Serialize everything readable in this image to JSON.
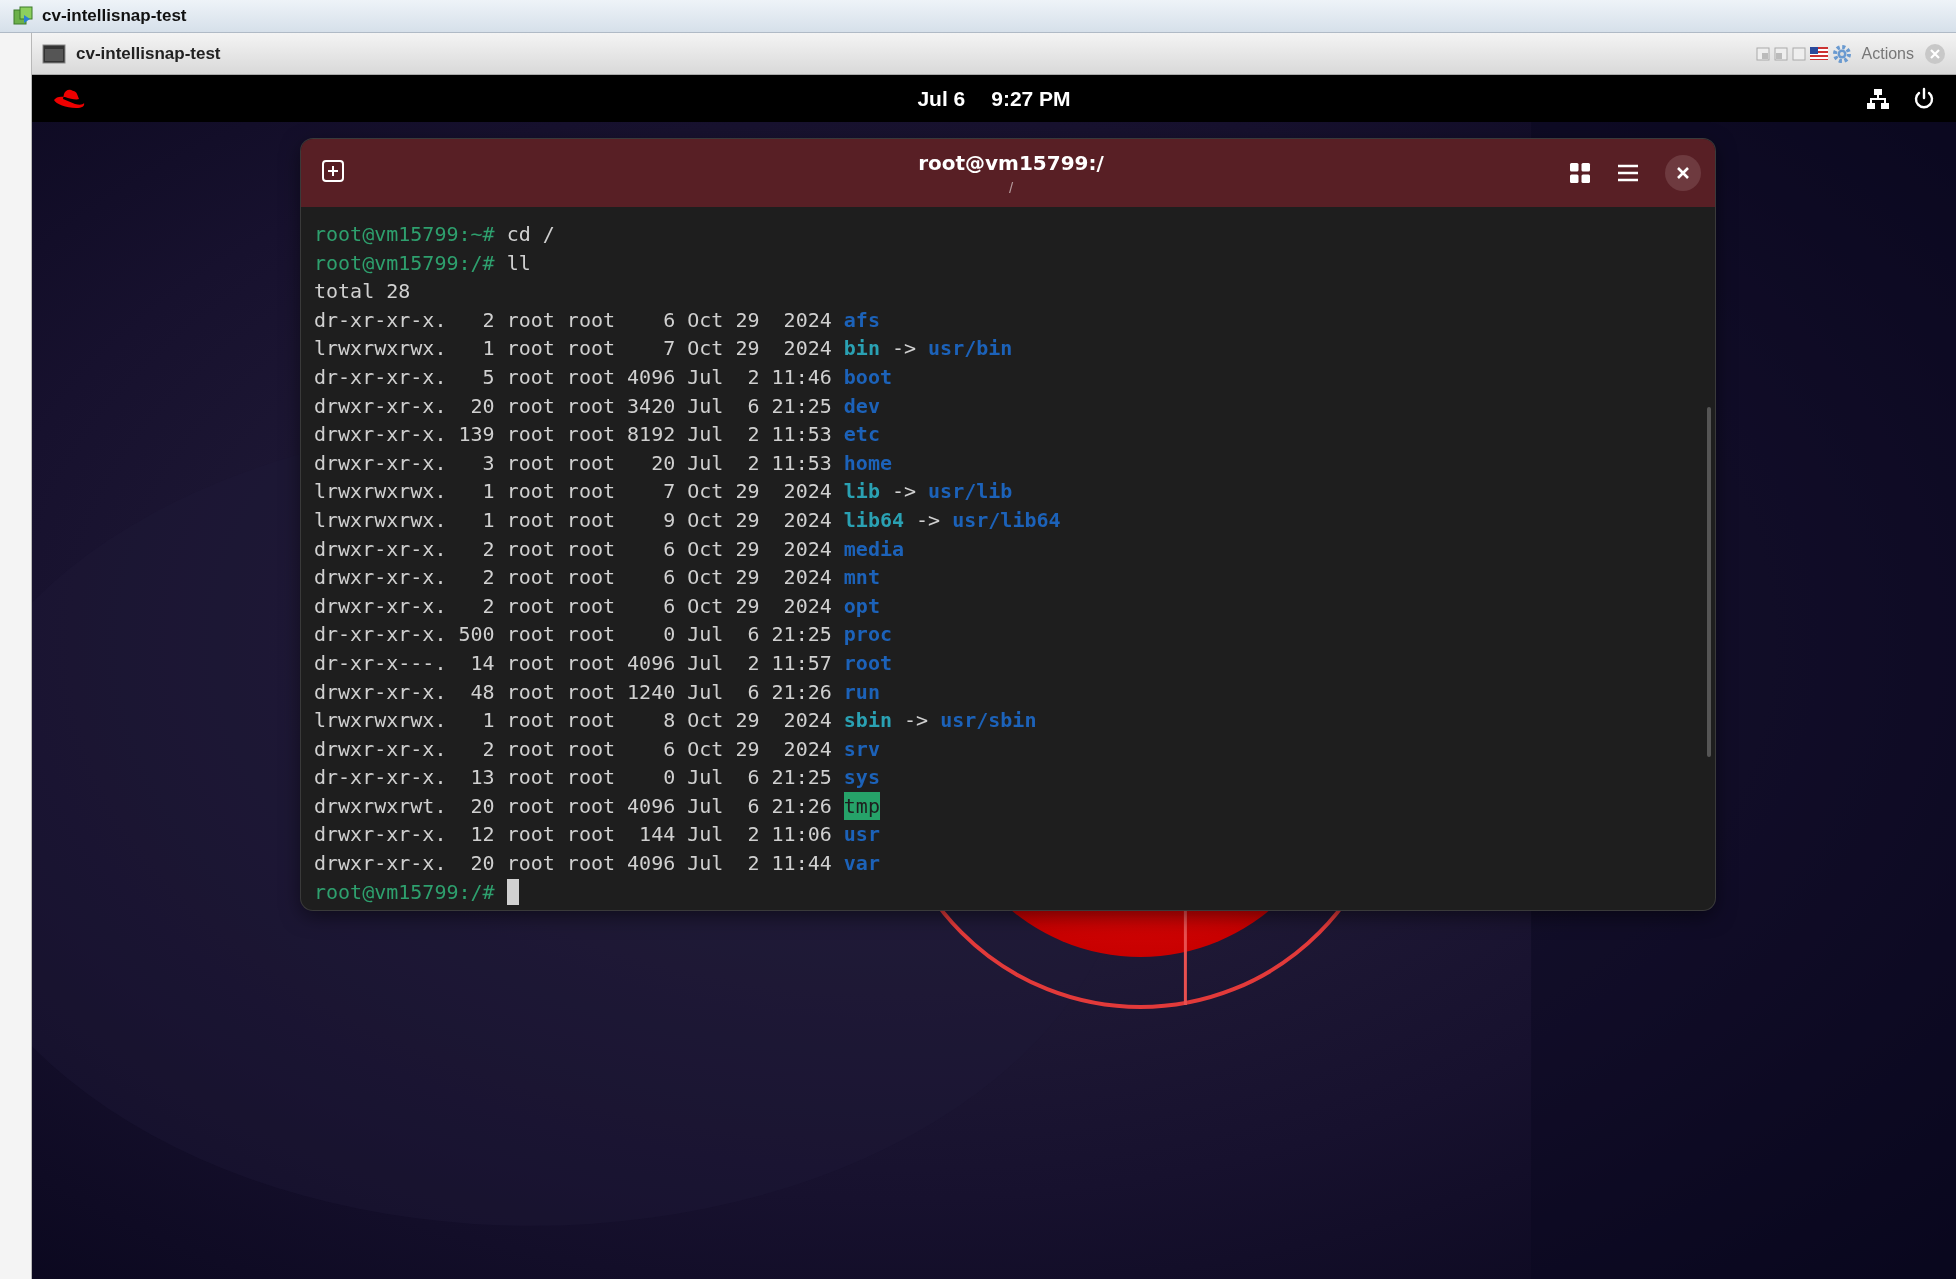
{
  "outer_window": {
    "title": "cv-intellisnap-test"
  },
  "console_window": {
    "title": "cv-intellisnap-test",
    "actions_label": "Actions"
  },
  "top_bar": {
    "date": "Jul 6",
    "time": "9:27 PM"
  },
  "terminal": {
    "title": "root@vm15799:/",
    "subtitle": "/",
    "lines": [
      {
        "kind": "prompt",
        "prompt": "root@vm15799:~#",
        "command": "cd /"
      },
      {
        "kind": "prompt",
        "prompt": "root@vm15799:/#",
        "command": "ll"
      },
      {
        "kind": "text",
        "text": "total 28"
      },
      {
        "kind": "entry",
        "info": "dr-xr-xr-x.   2 root root    6 Oct 29  2024",
        "file": {
          "name": "afs",
          "kind": "dir"
        }
      },
      {
        "kind": "entry",
        "info": "lrwxrwxrwx.   1 root root    7 Oct 29  2024",
        "file": {
          "name": "bin",
          "kind": "link"
        },
        "arrow": "->",
        "target": "usr/bin"
      },
      {
        "kind": "entry",
        "info": "dr-xr-xr-x.   5 root root 4096 Jul  2 11:46",
        "file": {
          "name": "boot",
          "kind": "dir"
        }
      },
      {
        "kind": "entry",
        "info": "drwxr-xr-x.  20 root root 3420 Jul  6 21:25",
        "file": {
          "name": "dev",
          "kind": "dir"
        }
      },
      {
        "kind": "entry",
        "info": "drwxr-xr-x. 139 root root 8192 Jul  2 11:53",
        "file": {
          "name": "etc",
          "kind": "dir"
        }
      },
      {
        "kind": "entry",
        "info": "drwxr-xr-x.   3 root root   20 Jul  2 11:53",
        "file": {
          "name": "home",
          "kind": "dir"
        }
      },
      {
        "kind": "entry",
        "info": "lrwxrwxrwx.   1 root root    7 Oct 29  2024",
        "file": {
          "name": "lib",
          "kind": "link"
        },
        "arrow": "->",
        "target": "usr/lib"
      },
      {
        "kind": "entry",
        "info": "lrwxrwxrwx.   1 root root    9 Oct 29  2024",
        "file": {
          "name": "lib64",
          "kind": "link"
        },
        "arrow": "->",
        "target": "usr/lib64"
      },
      {
        "kind": "entry",
        "info": "drwxr-xr-x.   2 root root    6 Oct 29  2024",
        "file": {
          "name": "media",
          "kind": "dir"
        }
      },
      {
        "kind": "entry",
        "info": "drwxr-xr-x.   2 root root    6 Oct 29  2024",
        "file": {
          "name": "mnt",
          "kind": "dir"
        }
      },
      {
        "kind": "entry",
        "info": "drwxr-xr-x.   2 root root    6 Oct 29  2024",
        "file": {
          "name": "opt",
          "kind": "dir"
        }
      },
      {
        "kind": "entry",
        "info": "dr-xr-xr-x. 500 root root    0 Jul  6 21:25",
        "file": {
          "name": "proc",
          "kind": "dir"
        }
      },
      {
        "kind": "entry",
        "info": "dr-xr-x---.  14 root root 4096 Jul  2 11:57",
        "file": {
          "name": "root",
          "kind": "dir"
        }
      },
      {
        "kind": "entry",
        "info": "drwxr-xr-x.  48 root root 1240 Jul  6 21:26",
        "file": {
          "name": "run",
          "kind": "dir"
        }
      },
      {
        "kind": "entry",
        "info": "lrwxrwxrwx.   1 root root    8 Oct 29  2024",
        "file": {
          "name": "sbin",
          "kind": "link"
        },
        "arrow": "->",
        "target": "usr/sbin"
      },
      {
        "kind": "entry",
        "info": "drwxr-xr-x.   2 root root    6 Oct 29  2024",
        "file": {
          "name": "srv",
          "kind": "dir"
        }
      },
      {
        "kind": "entry",
        "info": "dr-xr-xr-x.  13 root root    0 Jul  6 21:25",
        "file": {
          "name": "sys",
          "kind": "dir"
        }
      },
      {
        "kind": "entry",
        "info": "drwxrwxrwt.  20 root root 4096 Jul  6 21:26",
        "file": {
          "name": "tmp",
          "kind": "sticky"
        }
      },
      {
        "kind": "entry",
        "info": "drwxr-xr-x.  12 root root  144 Jul  2 11:06",
        "file": {
          "name": "usr",
          "kind": "dir"
        }
      },
      {
        "kind": "entry",
        "info": "drwxr-xr-x.  20 root root 4096 Jul  2 11:44",
        "file": {
          "name": "var",
          "kind": "dir"
        }
      },
      {
        "kind": "prompt",
        "prompt": "root@vm15799:/#",
        "cursor": true
      }
    ]
  }
}
